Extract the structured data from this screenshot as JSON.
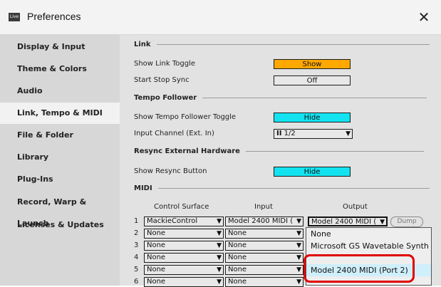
{
  "window": {
    "title": "Preferences",
    "app_icon": "Live",
    "close": "✕"
  },
  "sidebar": {
    "items": [
      {
        "label": "Display & Input"
      },
      {
        "label": "Theme & Colors"
      },
      {
        "label": "Audio"
      },
      {
        "label": "Link, Tempo & MIDI"
      },
      {
        "label": "File & Folder"
      },
      {
        "label": "Library"
      },
      {
        "label": "Plug-Ins"
      },
      {
        "label": "Record, Warp & Launch"
      },
      {
        "label": "Licenses & Updates"
      }
    ],
    "active_index": 3
  },
  "main": {
    "link": {
      "heading": "Link",
      "show_link_toggle": {
        "label": "Show Link Toggle",
        "value": "Show"
      },
      "start_stop_sync": {
        "label": "Start Stop Sync",
        "value": "Off"
      }
    },
    "tempo_follower": {
      "heading": "Tempo Follower",
      "show_toggle": {
        "label": "Show Tempo Follower Toggle",
        "value": "Hide"
      },
      "input_channel": {
        "label": "Input Channel (Ext. In)",
        "value": "1/2",
        "prefix": "II"
      }
    },
    "resync": {
      "heading": "Resync External Hardware",
      "show_button": {
        "label": "Show Resync Button",
        "value": "Hide"
      }
    },
    "midi": {
      "heading": "MIDI",
      "columns": {
        "surface": "Control Surface",
        "input": "Input",
        "output": "Output"
      },
      "rows": [
        {
          "num": "1",
          "surface": "MackieControl",
          "input": "Model 2400 MIDI (",
          "output": "Model 2400 MIDI ("
        },
        {
          "num": "2",
          "surface": "None",
          "input": "None",
          "output": ""
        },
        {
          "num": "3",
          "surface": "None",
          "input": "None",
          "output": ""
        },
        {
          "num": "4",
          "surface": "None",
          "input": "None",
          "output": ""
        },
        {
          "num": "5",
          "surface": "None",
          "input": "None",
          "output": ""
        },
        {
          "num": "6",
          "surface": "None",
          "input": "None",
          "output": ""
        }
      ],
      "dump_label": "Dump"
    },
    "output_dropdown": {
      "options": [
        "None",
        "Microsoft GS Wavetable Synth",
        "Model 2400 MIDI (Port 2)"
      ],
      "highlighted_index": 2,
      "highlight_color": "#e00000"
    }
  },
  "colors": {
    "show": "#ffa800",
    "hide": "#13e3f0",
    "sidebar": "#d7d7d7",
    "panel": "#e2e2e2"
  }
}
